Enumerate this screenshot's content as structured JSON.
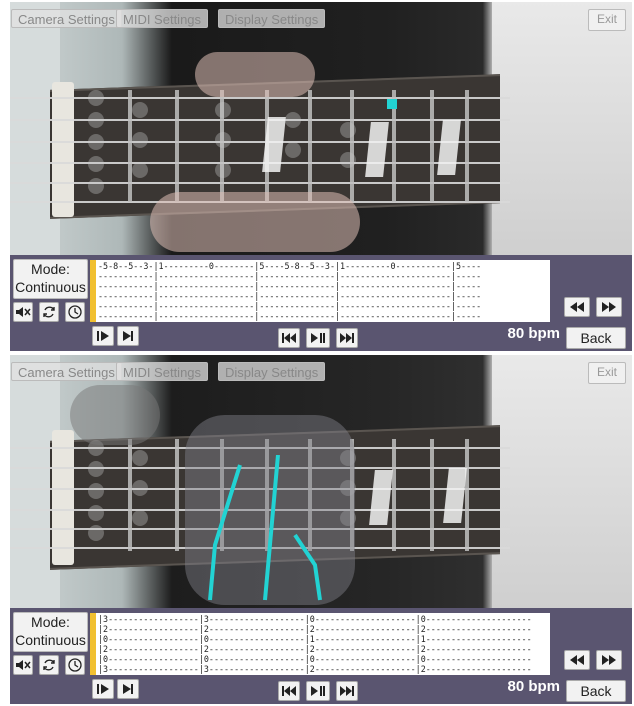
{
  "panels": [
    {
      "toolbar": {
        "camera_settings": "Camera Settings",
        "midi_settings": "MIDI Settings",
        "display_settings": "Display Settings",
        "exit": "Exit"
      },
      "mode": {
        "line1": "Mode:",
        "line2": "Continuous"
      },
      "tab_lines": [
        "-5-8--5--3-|1---------0--------|5----5-8--5--3-|1---------0-----------|5----",
        "-----------|-------------------|---------------|----------------------|-----",
        "-----------|-------------------|---------------|----------------------|-----",
        "-----------|-------------------|---------------|----------------------|-----",
        "-----------|-------------------|---------------|----------------------|-----",
        "-----------|-------------------|---------------|----------------------|-----"
      ],
      "bpm": "80 bpm",
      "back": "Back"
    },
    {
      "toolbar": {
        "camera_settings": "Camera Settings",
        "midi_settings": "MIDI Settings",
        "display_settings": "Display Settings",
        "exit": "Exit"
      },
      "mode": {
        "line1": "Mode:",
        "line2": "Continuous"
      },
      "tab_lines": [
        "|3------------------|3-------------------|0--------------------|0---------------------",
        "|2------------------|2-------------------|2--------------------|2---------------------",
        "|0------------------|0-------------------|1--------------------|1---------------------",
        "|2------------------|2-------------------|2--------------------|2---------------------",
        "|0------------------|0-------------------|0--------------------|0---------------------",
        "|3------------------|3-------------------|2--------------------|2---------------------"
      ],
      "bpm": "80 bpm",
      "back": "Back"
    }
  ],
  "icons": {
    "mute": "mute-icon",
    "loop": "loop-icon",
    "metronome": "metronome-icon",
    "step": "step-forward-icon",
    "next_note": "next-note-icon",
    "skip_back": "skip-back-icon",
    "play_pause": "play-pause-icon",
    "skip_forward": "skip-forward-icon",
    "rewind": "rewind-icon",
    "fast_forward": "fast-forward-icon"
  },
  "colors": {
    "controls_bg": "#5a5570",
    "tab_marker": "#f1c030",
    "finger_overlay": "#22d3d3"
  }
}
